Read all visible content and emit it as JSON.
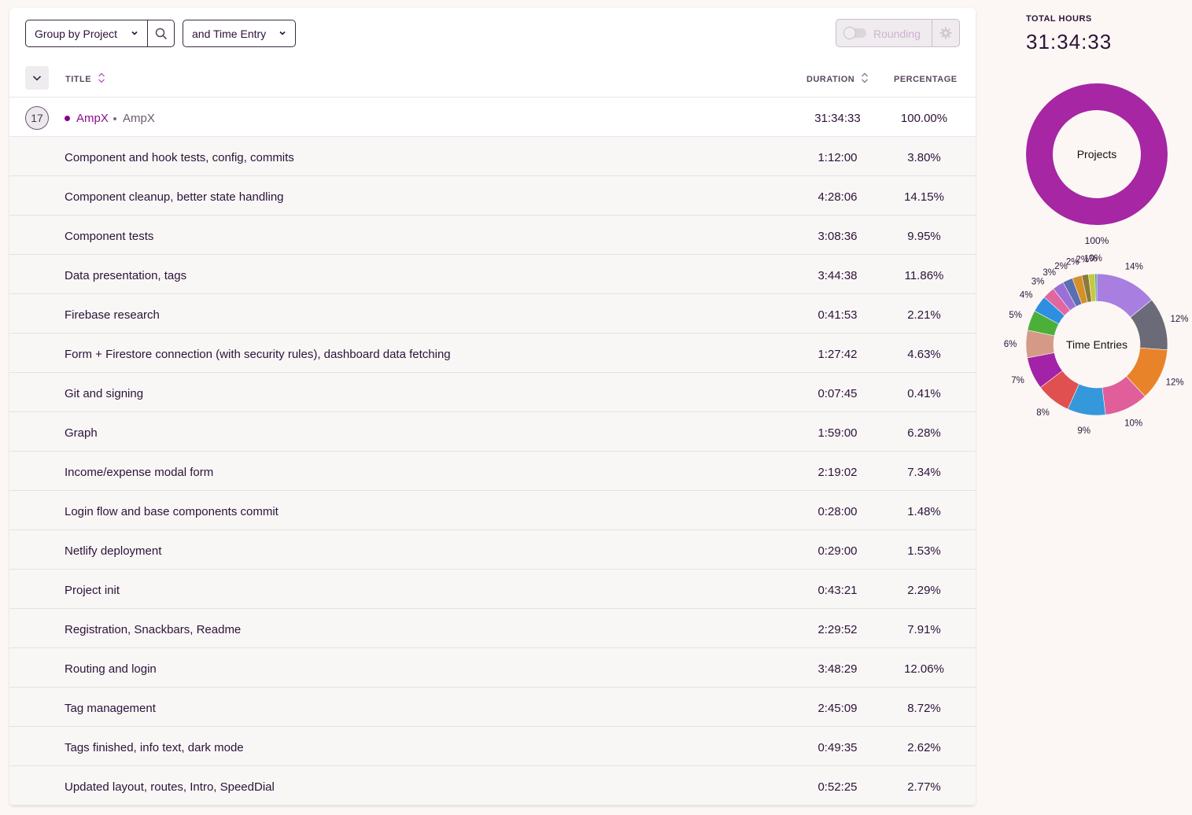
{
  "toolbar": {
    "group_by_label": "Group by Project",
    "sub_group_label": "and Time Entry",
    "rounding_label": "Rounding"
  },
  "table": {
    "headers": {
      "title": "TITLE",
      "duration": "DURATION",
      "percentage": "PERCENTAGE"
    },
    "project": {
      "count": "17",
      "name": "AmpX",
      "client": "AmpX",
      "duration": "31:34:33",
      "percentage": "100.00%",
      "color": "#8b008b"
    },
    "entries": [
      {
        "title": "Component and hook tests, config, commits",
        "duration": "1:12:00",
        "percentage": "3.80%"
      },
      {
        "title": "Component cleanup, better state handling",
        "duration": "4:28:06",
        "percentage": "14.15%"
      },
      {
        "title": "Component tests",
        "duration": "3:08:36",
        "percentage": "9.95%"
      },
      {
        "title": "Data presentation, tags",
        "duration": "3:44:38",
        "percentage": "11.86%"
      },
      {
        "title": "Firebase research",
        "duration": "0:41:53",
        "percentage": "2.21%"
      },
      {
        "title": "Form + Firestore connection (with security rules), dashboard data fetching",
        "duration": "1:27:42",
        "percentage": "4.63%"
      },
      {
        "title": "Git and signing",
        "duration": "0:07:45",
        "percentage": "0.41%"
      },
      {
        "title": "Graph",
        "duration": "1:59:00",
        "percentage": "6.28%"
      },
      {
        "title": "Income/expense modal form",
        "duration": "2:19:02",
        "percentage": "7.34%"
      },
      {
        "title": "Login flow and base components commit",
        "duration": "0:28:00",
        "percentage": "1.48%"
      },
      {
        "title": "Netlify deployment",
        "duration": "0:29:00",
        "percentage": "1.53%"
      },
      {
        "title": "Project init",
        "duration": "0:43:21",
        "percentage": "2.29%"
      },
      {
        "title": "Registration, Snackbars, Readme",
        "duration": "2:29:52",
        "percentage": "7.91%"
      },
      {
        "title": "Routing and login",
        "duration": "3:48:29",
        "percentage": "12.06%"
      },
      {
        "title": "Tag management",
        "duration": "2:45:09",
        "percentage": "8.72%"
      },
      {
        "title": "Tags finished, info text, dark mode",
        "duration": "0:49:35",
        "percentage": "2.62%"
      },
      {
        "title": "Updated layout, routes, Intro, SpeedDial",
        "duration": "0:52:25",
        "percentage": "2.77%"
      }
    ]
  },
  "sidebar": {
    "total_label": "TOTAL HOURS",
    "total_value": "31:34:33"
  },
  "chart_data": [
    {
      "type": "pie",
      "title": "Projects",
      "categories": [
        "AmpX"
      ],
      "values": [
        100
      ],
      "labels": [
        "100%"
      ],
      "colors": [
        "#a626a4"
      ]
    },
    {
      "type": "pie",
      "title": "Time Entries",
      "values": [
        14.15,
        12.06,
        11.86,
        9.95,
        8.72,
        7.91,
        7.34,
        6.28,
        4.63,
        3.8,
        2.77,
        2.62,
        2.29,
        2.21,
        1.53,
        1.48,
        0.41
      ],
      "labels": [
        "14%",
        "12%",
        "12%",
        "10%",
        "9%",
        "8%",
        "7%",
        "6%",
        "5%",
        "4%",
        "3%",
        "3%",
        "2%",
        "2%",
        "2%",
        "1%",
        "0%"
      ],
      "colors": [
        "#a87ee0",
        "#6b6a78",
        "#e8832a",
        "#e05e9a",
        "#3498db",
        "#e05050",
        "#a323a8",
        "#d49a86",
        "#4caf3a",
        "#2e8fe0",
        "#e066a0",
        "#9b6fd6",
        "#5a6fb0",
        "#d4902a",
        "#8a7a3a",
        "#c8c840",
        "#2eaa8a"
      ]
    }
  ]
}
